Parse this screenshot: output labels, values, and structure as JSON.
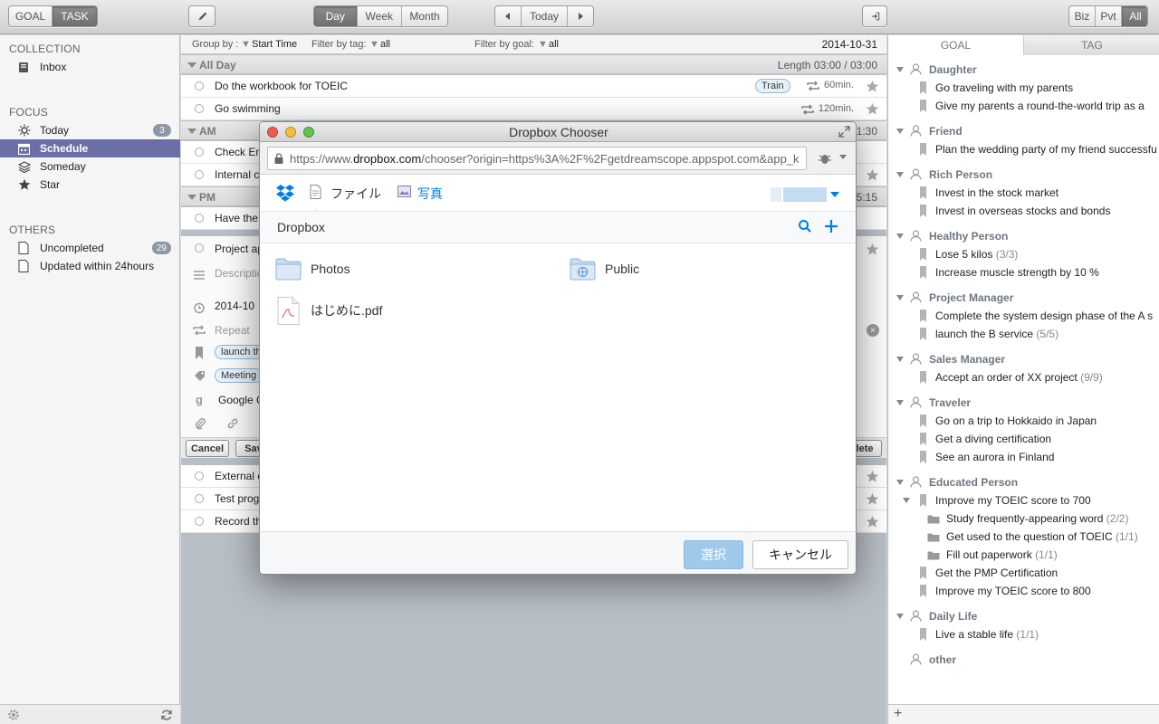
{
  "toolbar": {
    "mode_tabs": [
      "GOAL",
      "TASK"
    ],
    "view_tabs": [
      "Day",
      "Week",
      "Month"
    ],
    "nav": {
      "today": "Today"
    },
    "filter_tabs": [
      "Biz",
      "Pvt",
      "All"
    ]
  },
  "sidebar": {
    "collection_title": "COLLECTION",
    "inbox": "Inbox",
    "focus_title": "FOCUS",
    "focus_items": [
      {
        "label": "Today",
        "count": "3"
      },
      {
        "label": "Schedule"
      },
      {
        "label": "Someday"
      },
      {
        "label": "Star"
      }
    ],
    "others_title": "OTHERS",
    "others_items": [
      {
        "label": "Uncompleted",
        "count": "29"
      },
      {
        "label": "Updated within 24hours"
      }
    ]
  },
  "main": {
    "filter": {
      "group_by_label": "Group by :",
      "group_by_value": "Start Time",
      "tag_label": "Filter by tag:",
      "tag_value": "all",
      "goal_label": "Filter by goal:",
      "goal_value": "all",
      "date": "2014-10-31"
    },
    "groups": {
      "allday": {
        "title": "All Day",
        "length": "Length 03:00 / 03:00"
      },
      "am": {
        "title": "AM",
        "time": "1:30"
      },
      "pm": {
        "title": "PM",
        "time": "5:15"
      }
    },
    "tasks": {
      "toeic": {
        "title": "Do the workbook for TOEIC",
        "tag": "Train",
        "duration": "60min."
      },
      "swim": {
        "title": "Go swimming",
        "duration": "120min."
      },
      "am1": "Check Em",
      "am2": "Internal c",
      "pm1": "Have the",
      "pm2": "Project ap",
      "after1": "External c",
      "after2": "Test prog",
      "after3": "Record th"
    },
    "edit": {
      "description": "Descriptio",
      "date": "2014-10",
      "repeat": "Repeat",
      "goal_tag": "launch th",
      "tag": "Meeting",
      "google": "Google C",
      "cancel": "Cancel",
      "save": "Sav",
      "delete": "elete"
    }
  },
  "right": {
    "tabs": [
      "GOAL",
      "TAG"
    ],
    "goals": [
      {
        "kind": "h",
        "label": "Daughter"
      },
      {
        "kind": "i",
        "label": "Go traveling with my parents"
      },
      {
        "kind": "i",
        "label": "Give my parents a round-the-world trip as a"
      },
      {
        "kind": "h",
        "label": "Friend"
      },
      {
        "kind": "i",
        "label": "Plan the wedding party of my friend successfu"
      },
      {
        "kind": "h",
        "label": "Rich Person"
      },
      {
        "kind": "i",
        "label": "Invest in the stock market"
      },
      {
        "kind": "i",
        "label": "Invest in overseas stocks and bonds"
      },
      {
        "kind": "h",
        "label": "Healthy Person"
      },
      {
        "kind": "i",
        "label": "Lose 5 kilos",
        "progress": "(3/3)"
      },
      {
        "kind": "i",
        "label": "Increase muscle strength by 10 %"
      },
      {
        "kind": "h",
        "label": "Project Manager"
      },
      {
        "kind": "i",
        "label": "Complete the system design phase of the A s"
      },
      {
        "kind": "i",
        "label": "launch the B service",
        "progress": "(5/5)"
      },
      {
        "kind": "h",
        "label": "Sales Manager"
      },
      {
        "kind": "i",
        "label": "Accept an order of XX project",
        "progress": "(9/9)"
      },
      {
        "kind": "h",
        "label": "Traveler"
      },
      {
        "kind": "i",
        "label": "Go on a trip to Hokkaido in Japan"
      },
      {
        "kind": "i",
        "label": "Get a diving certification"
      },
      {
        "kind": "i",
        "label": "See an aurora in Finland"
      },
      {
        "kind": "h",
        "label": "Educated Person"
      },
      {
        "kind": "ie",
        "label": "Improve my TOEIC score to 700"
      },
      {
        "kind": "s",
        "label": "Study frequently-appearing word",
        "progress": "(2/2)"
      },
      {
        "kind": "s",
        "label": "Get used to the question of TOEIC",
        "progress": "(1/1)"
      },
      {
        "kind": "s",
        "label": "Fill out paperwork",
        "progress": "(1/1)"
      },
      {
        "kind": "i",
        "label": "Get the PMP Certification"
      },
      {
        "kind": "i",
        "label": "Improve my TOEIC score to 800"
      },
      {
        "kind": "h",
        "label": "Daily Life"
      },
      {
        "kind": "i",
        "label": "Live a stable life",
        "progress": "(1/1)"
      },
      {
        "kind": "o",
        "label": "other"
      }
    ]
  },
  "dialog": {
    "title": "Dropbox Chooser",
    "url_prefix": "https://www.",
    "url_domain": "dropbox.com",
    "url_rest": "/chooser?origin=https%3A%2F%2Fgetdreamscope.appspot.com&app_k",
    "tab_files": "ファイル",
    "tab_photos": "写真",
    "breadcrumb": "Dropbox",
    "items": {
      "photos": "Photos",
      "public": "Public",
      "pdf": "はじめに.pdf"
    },
    "choose": "選択",
    "cancel": "キャンセル"
  },
  "colors": {
    "selected_sidebar": "#6b6fa8",
    "dropbox_blue": "#007ee5",
    "choose_button": "#9fc8ea"
  }
}
